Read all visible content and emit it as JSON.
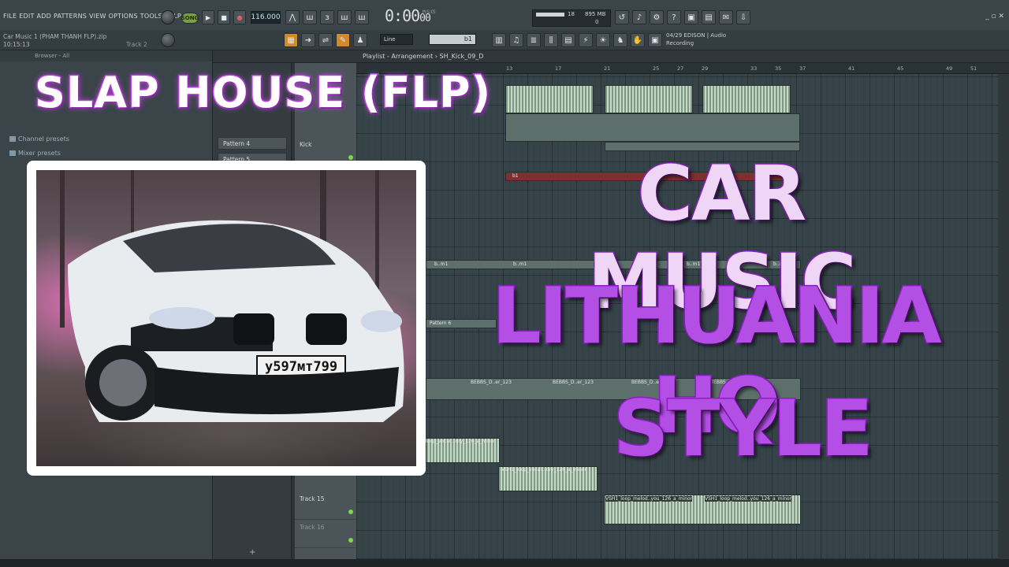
{
  "menu": {
    "items": [
      "FILE",
      "EDIT",
      "ADD",
      "PATTERNS",
      "VIEW",
      "OPTIONS",
      "TOOLS",
      "HELP"
    ]
  },
  "transport": {
    "song_label": "SONG",
    "tempo": "116.000",
    "time": "0:00",
    "time_unit": "00",
    "time_sub": "M:S:CS"
  },
  "project": {
    "filename": "Car Music 1 (PHAM THANH FLP).zip",
    "clock": "10:15:13",
    "track": "Track 2"
  },
  "cpu": {
    "cores": "18",
    "memory": "895 MB",
    "polyphony": "0"
  },
  "hint": {
    "line1": "04/29  EDISON | Audio",
    "line2": "Recording"
  },
  "tools": {
    "snap": "Line",
    "pattern": "b1"
  },
  "browser": {
    "header": "Browser - All",
    "items": [
      "Channel presets",
      "Mixer presets"
    ]
  },
  "patterns": [
    "Pattern 4",
    "Pattern 5"
  ],
  "playlist": {
    "title": "Playlist - Arrangement",
    "clip": "SH_Kick_09_D"
  },
  "ruler": [
    "13",
    "17",
    "21",
    "25",
    "27",
    "29",
    "33",
    "35",
    "37",
    "41",
    "45",
    "49",
    "51"
  ],
  "tracks": [
    {
      "name": "Kick"
    },
    {
      "name": "Track 15"
    },
    {
      "name": "Track 16"
    }
  ],
  "clips": {
    "b_m1": "b..m1",
    "bebbs": "BEBBS_D..er_123",
    "vocal1": "loop_vocal...dry_126_a_minor",
    "vocal2": "VSH1_loop_vocal...dry_126_a_minor",
    "melod1": "VSH1_loop_melod..you_126_a_minor",
    "melod2": "VSH1_loop_melod..you_126_a_minor",
    "pattern": "Pattern 6",
    "red": "b1"
  },
  "overlay": {
    "top_title": "SLAP HOUSE (FLP)",
    "line1": "CAR MUSIC",
    "line2": "LITHUANIA HQ",
    "line3": "STYLE",
    "plate": "у597мт799"
  },
  "colors": {
    "accent_purple": "#8b1fc0",
    "song_green": "#7ea043",
    "grid": "#36444a"
  }
}
